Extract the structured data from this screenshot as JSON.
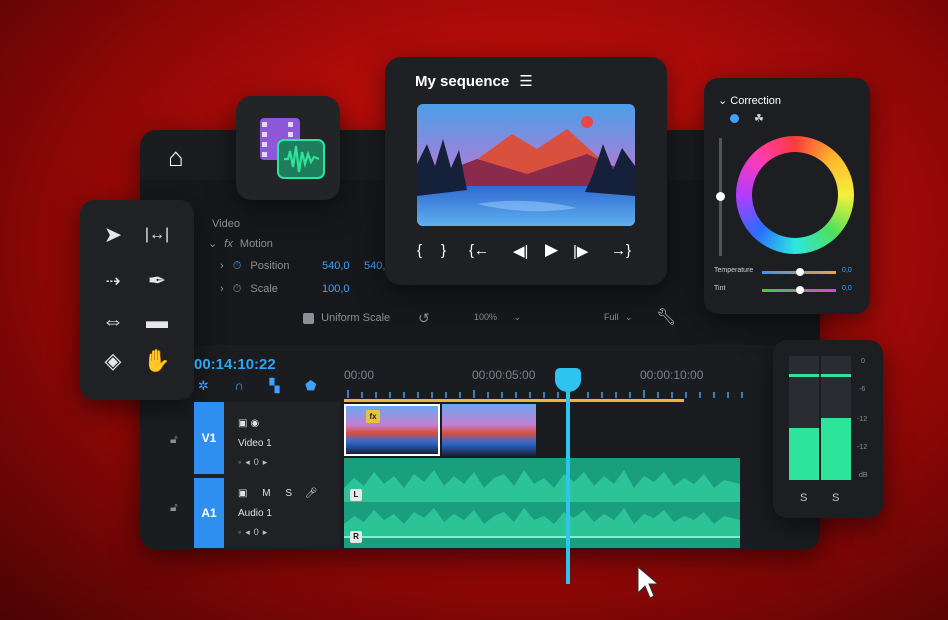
{
  "app": {
    "home_icon": "home-icon"
  },
  "media_tile": {
    "icon": "media-film-audio-icon"
  },
  "tools": [
    {
      "icon": "selection-arrow-icon"
    },
    {
      "icon": "ripple-edit-icon"
    },
    {
      "icon": "track-select-icon"
    },
    {
      "icon": "pen-icon"
    },
    {
      "icon": "slip-icon"
    },
    {
      "icon": "rectangle-icon"
    },
    {
      "icon": "razor-icon"
    },
    {
      "icon": "hand-icon"
    }
  ],
  "effect_controls": {
    "section": "Video",
    "effect": "Motion",
    "position_label": "Position",
    "position_x": "540,0",
    "position_y": "540,",
    "scale_label": "Scale",
    "scale_value": "100,0",
    "uniform_scale_label": "Uniform Scale",
    "zoom": "100%",
    "quality": "Full"
  },
  "monitor": {
    "title": "My sequence",
    "menu_icon": "hamburger-menu-icon"
  },
  "color_correction": {
    "title": "Correction",
    "temperature_label": "Temperature",
    "temperature_value": "0,0",
    "tint_label": "Tint",
    "tint_value": "0,0"
  },
  "timeline": {
    "timecode": "00:14:10:22",
    "ruler": [
      "00:00",
      "00:00:05:00",
      "00:00:10:00"
    ],
    "tracks": [
      {
        "badge": "V1",
        "name": "Video 1",
        "value": "0"
      },
      {
        "badge": "A1",
        "name": "Audio 1",
        "value": "0",
        "mute": "M",
        "solo": "S"
      }
    ],
    "fx": "fx",
    "left_channel": "L",
    "right_channel": "R"
  },
  "audio_meter": {
    "scale": [
      "0",
      "-6",
      "-12",
      "-12",
      "dB"
    ],
    "solo_left": "S",
    "solo_right": "S",
    "levels": [
      0.42,
      0.5
    ]
  },
  "colors": {
    "accent_blue": "#2aa7f0",
    "clip_green": "#20b48c",
    "playhead": "#2fc4f0",
    "fx_yellow": "#e8c43a"
  }
}
